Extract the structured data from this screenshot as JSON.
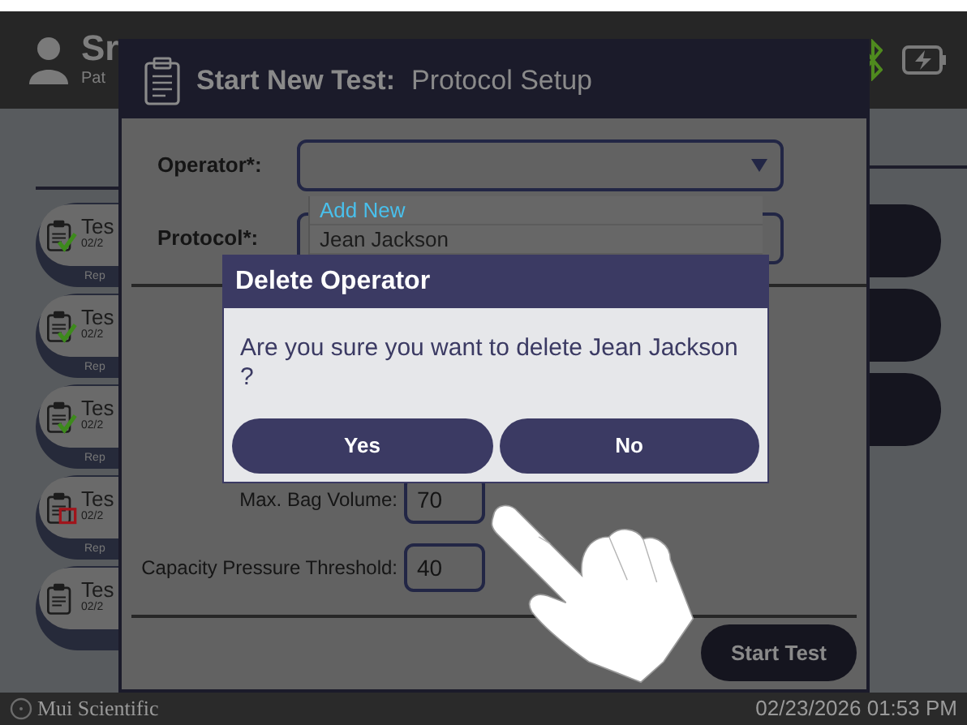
{
  "header": {
    "title": "Sr",
    "subtitle": "Pat"
  },
  "test_list": [
    {
      "title": "Tes",
      "date": "02/2",
      "footer": "Rep",
      "kind": "pass"
    },
    {
      "title": "Tes",
      "date": "02/2",
      "footer": "Rep",
      "kind": "pass"
    },
    {
      "title": "Tes",
      "date": "02/2",
      "footer": "Rep",
      "kind": "pass"
    },
    {
      "title": "Tes",
      "date": "02/2",
      "footer": "Rep",
      "kind": "fail"
    },
    {
      "title": "Tes",
      "date": "02/2",
      "kind": "plain"
    }
  ],
  "footer": {
    "brand": "Mui Scientific",
    "datetime": "02/23/2026 01:53 PM"
  },
  "setup_dialog": {
    "title": "Start New Test:",
    "subtitle": "Protocol Setup",
    "top_fields": [
      {
        "label": "Operator*:",
        "kind": "select"
      },
      {
        "label": "Protocol*:",
        "kind": "text"
      }
    ],
    "dropdown_options": [
      {
        "label": "Add New",
        "kind": "action"
      },
      {
        "label": "Jean Jackson",
        "kind": "option"
      }
    ],
    "bottom_fields": [
      {
        "label": "Max. Bag Volume:",
        "value": "70"
      },
      {
        "label": "Capacity Pressure Threshold:",
        "value": "40"
      }
    ],
    "start_button": "Start Test"
  },
  "confirm_dialog": {
    "title": "Delete Operator",
    "message": "Are you sure you want to delete Jean Jackson ?",
    "buttons": [
      "Yes",
      "No"
    ]
  }
}
